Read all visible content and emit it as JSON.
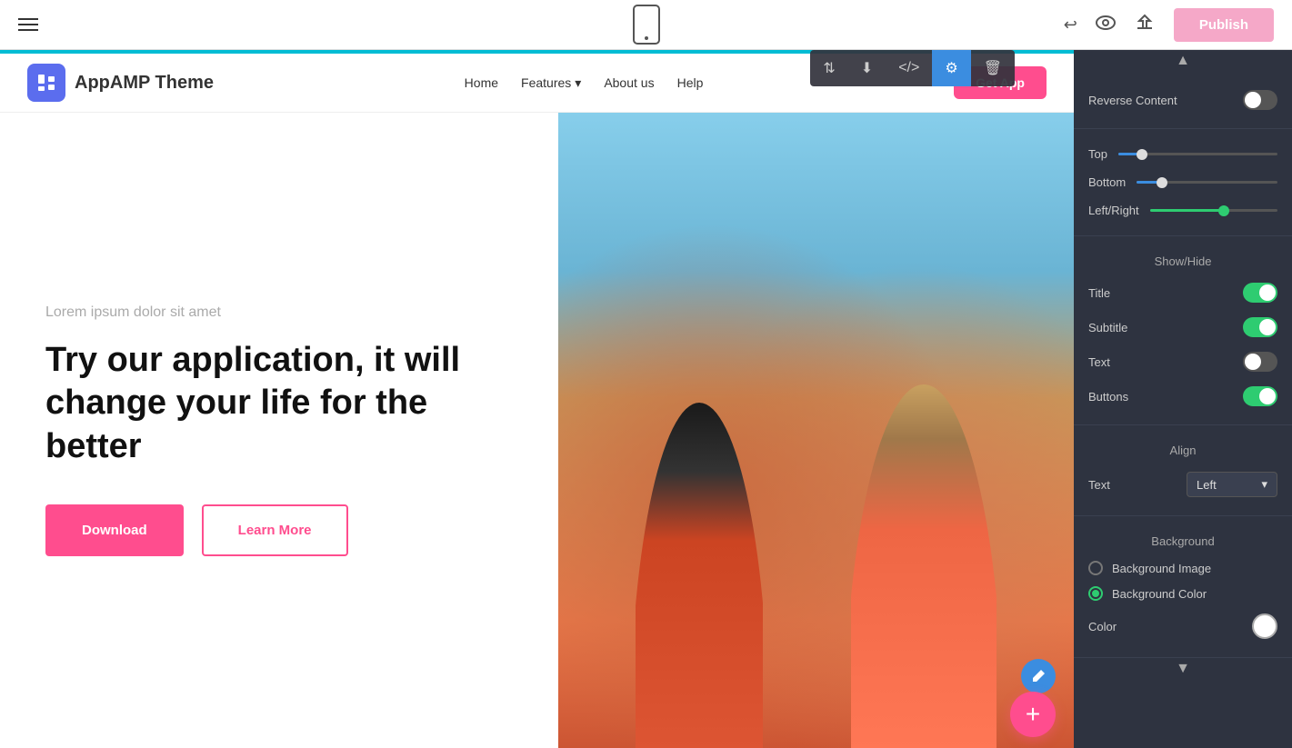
{
  "toolbar": {
    "publish_label": "Publish"
  },
  "site": {
    "logo_text": "AppAMP Theme",
    "nav": {
      "home": "Home",
      "features": "Features",
      "about": "About us",
      "help": "Help"
    },
    "get_app_label": "Get App"
  },
  "hero": {
    "subtitle": "Lorem ipsum dolor sit amet",
    "title": "Try our application, it will change your life for the better",
    "download_label": "Download",
    "learn_more_label": "Learn More"
  },
  "panel": {
    "reverse_content_label": "Reverse Content",
    "top_label": "Top",
    "bottom_label": "Bottom",
    "left_right_label": "Left/Right",
    "show_hide_heading": "Show/Hide",
    "title_label": "Title",
    "subtitle_label": "Subtitle",
    "text_label": "Text",
    "buttons_label": "Buttons",
    "align_heading": "Align",
    "text_align_label": "Text",
    "text_align_value": "Left",
    "background_heading": "Background",
    "bg_image_label": "Background Image",
    "bg_color_label": "Background Color",
    "color_label": "Color",
    "sliders": {
      "top_percent": 15,
      "bottom_percent": 18,
      "left_right_percent": 58
    },
    "toggles": {
      "reverse_content": false,
      "title": true,
      "subtitle": true,
      "text": false,
      "buttons": true
    },
    "bg_image_checked": false,
    "bg_color_checked": true
  },
  "action_bar": {
    "reorder_icon": "⇅",
    "download_icon": "⬇",
    "code_icon": "</>",
    "settings_icon": "⚙",
    "delete_icon": "🗑"
  }
}
